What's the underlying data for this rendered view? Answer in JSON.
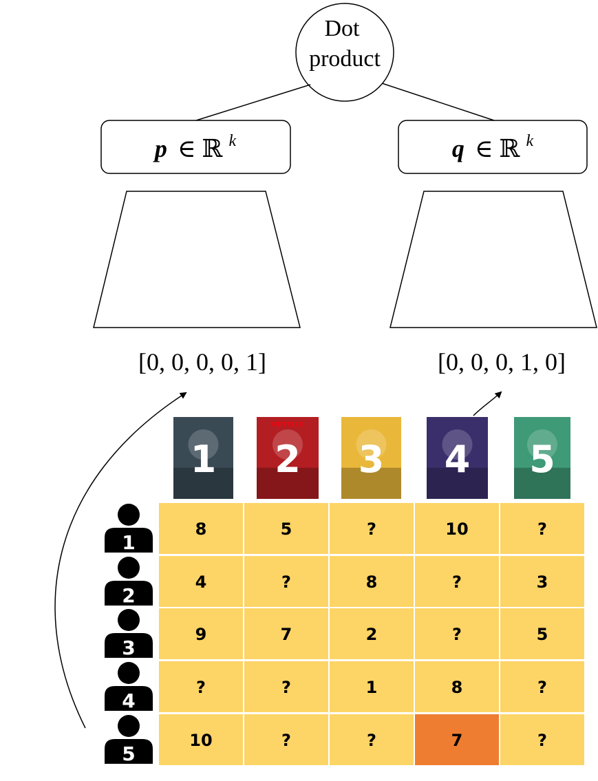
{
  "dot_node": {
    "line1": "Dot",
    "line2": "product"
  },
  "user_embedding": {
    "var": "p",
    "set": "∈ ℝ",
    "exp": "k"
  },
  "item_embedding": {
    "var": "q",
    "set": "∈ ℝ",
    "exp": "k"
  },
  "user_onehot": "[0, 0, 0, 0, 1]",
  "item_onehot": "[0, 0, 0, 1, 0]",
  "movies": [
    {
      "id": "1",
      "color": "#3a4a55",
      "logo": ""
    },
    {
      "id": "2",
      "color": "#b21e22",
      "logo": "NETFLIX"
    },
    {
      "id": "3",
      "color": "#e9b73a",
      "logo": ""
    },
    {
      "id": "4",
      "color": "#3b2f6b",
      "logo": ""
    },
    {
      "id": "5",
      "color": "#3f9a77",
      "logo": ""
    }
  ],
  "users": [
    "1",
    "2",
    "3",
    "4",
    "5"
  ],
  "ratings": [
    [
      "8",
      "5",
      "?",
      "10",
      "?"
    ],
    [
      "4",
      "?",
      "8",
      "?",
      "3"
    ],
    [
      "9",
      "7",
      "2",
      "?",
      "5"
    ],
    [
      "?",
      "?",
      "1",
      "8",
      "?"
    ],
    [
      "10",
      "?",
      "?",
      "7",
      "?"
    ]
  ],
  "highlight": {
    "row": 4,
    "col": 3
  },
  "colors": {
    "cell": "#fdd466",
    "highlight": "#ee7d31",
    "icon": "#000000"
  }
}
